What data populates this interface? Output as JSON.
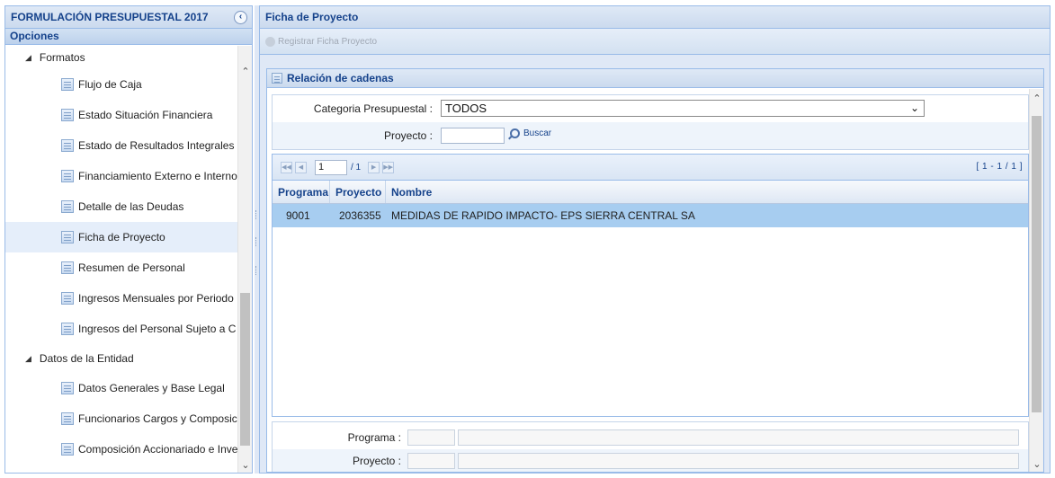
{
  "left_panel": {
    "title": "FORMULACIÓN PRESUPUESTAL 2017",
    "collapse_glyph": "‹",
    "section": "Opciones",
    "groups": [
      {
        "label": "Formatos",
        "items": [
          {
            "label": "Flujo de Caja"
          },
          {
            "label": "Estado Situación Financiera"
          },
          {
            "label": "Estado de Resultados Integrales"
          },
          {
            "label": "Financiamiento Externo e Interno"
          },
          {
            "label": "Detalle de las Deudas"
          },
          {
            "label": "Ficha de Proyecto",
            "selected": true
          },
          {
            "label": "Resumen de Personal"
          },
          {
            "label": "Ingresos Mensuales por Periodo"
          },
          {
            "label": "Ingresos del Personal Sujeto a C"
          }
        ]
      },
      {
        "label": "Datos de la Entidad",
        "items": [
          {
            "label": "Datos Generales y Base Legal"
          },
          {
            "label": "Funcionarios Cargos y Composic"
          },
          {
            "label": "Composición Accionariado e Inve"
          }
        ]
      }
    ]
  },
  "right_panel": {
    "title": "Ficha de Proyecto",
    "toolbar": {
      "register_label": "Registrar Ficha Proyecto"
    },
    "section_title": "Relación de cadenas",
    "filters": {
      "categoria_label": "Categoria Presupuestal :",
      "categoria_value": "TODOS",
      "proyecto_label": "Proyecto :",
      "proyecto_value": "",
      "buscar_label": "Buscar"
    },
    "pager": {
      "page": "1",
      "of": "/ 1",
      "range": "[ 1 - 1 / 1 ]"
    },
    "grid": {
      "columns": [
        "Programa",
        "Proyecto",
        "Nombre"
      ],
      "rows": [
        {
          "programa": "9001",
          "proyecto": "2036355",
          "nombre": "MEDIDAS DE RAPIDO IMPACTO- EPS SIERRA CENTRAL SA"
        }
      ]
    },
    "detail": {
      "programa_label": "Programa :",
      "proyecto_label": "Proyecto :"
    }
  },
  "colors": {
    "header_text": "#15428b",
    "border": "#99bbe8",
    "selected_row": "#a7cdf0",
    "panel_bg": "#dfe8f6"
  }
}
